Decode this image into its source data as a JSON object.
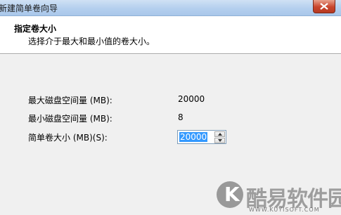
{
  "window": {
    "title": "新建简单卷向导"
  },
  "header": {
    "title": "指定卷大小",
    "subtitle": "选择介于最大和最小值的卷大小。"
  },
  "fields": {
    "max_label": "最大磁盘空间量 (MB):",
    "max_value": "20000",
    "min_label": "最小磁盘空间量 (MB):",
    "min_value": "8",
    "size_label": "简单卷大小 (MB)(S):",
    "size_value": "20000"
  },
  "watermark": {
    "logo_letter": "K",
    "name": "酷易软件园",
    "url": "WWW.KUYISOFT.COM"
  },
  "colors": {
    "titlebar": "#b4cfee",
    "selection": "#3399ff",
    "background": "#f0f0f0"
  }
}
